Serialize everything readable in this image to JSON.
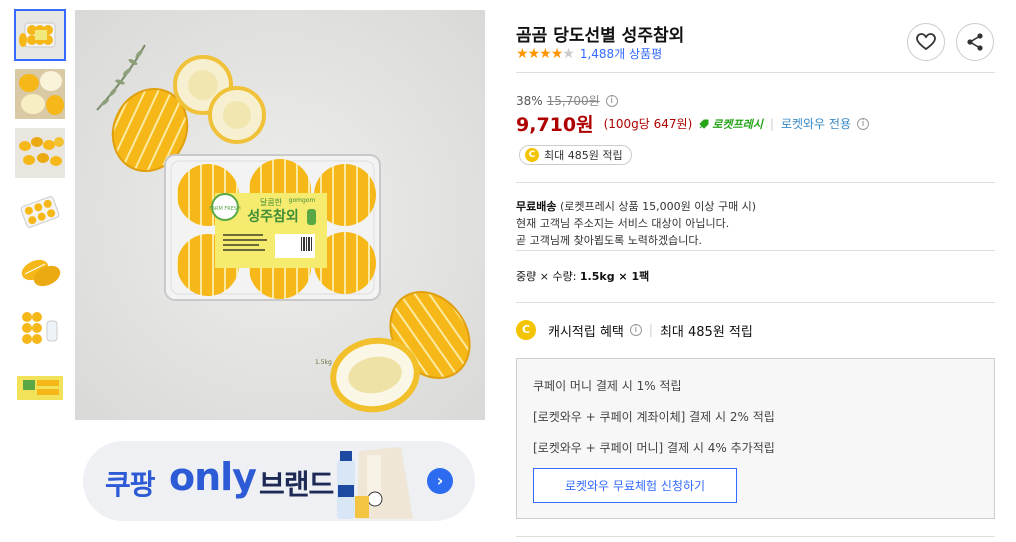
{
  "product": {
    "title": "곰곰 당도선별 성주참외",
    "rating": 4,
    "rating_max": 5,
    "review_count": "1,488개 상품평",
    "discount_rate": "38%",
    "original_price": "15,700원",
    "sale_price": "9,710원",
    "unit_price": "(100g당 647원)",
    "rocket_label": "로켓프레시",
    "wow_label": "로켓와우 전용",
    "cash_pill": "최대 485원 적립",
    "coin_symbol": "C"
  },
  "shipping": {
    "title": "무료배송",
    "condition": "(로켓프레시 상품 15,000원 이상 구매 시)",
    "line2": "현재 고객님 주소지는 서비스 대상이 아닙니다.",
    "line3": "곧 고객님께 찾아뵙도록 노력하겠습니다."
  },
  "spec": {
    "label": "중량 × 수량:",
    "value": "1.5kg × 1팩"
  },
  "cashback": {
    "label": "캐시적립 혜택",
    "value": "최대 485원 적립"
  },
  "benefits": {
    "lines": [
      "쿠페이 머니 결제 시 1% 적립",
      "[로켓와우 + 쿠페이 계좌이체] 결제 시 2% 적립",
      "[로켓와우 + 쿠페이 머니] 결제 시 4% 추가적립"
    ],
    "button": "로켓와우 무료체험 신청하기"
  },
  "banner": {
    "brand_ko": "쿠팡",
    "only": "only",
    "brand_word": "브랜드",
    "arrow": "›"
  },
  "image_label": {
    "badge": "FARM FRESH",
    "name_small": "달콤한",
    "name_big": "성주참외",
    "brand": "gomgom",
    "weight": "1.5kg"
  },
  "icons": {
    "heart": "heart-icon",
    "share": "share-icon",
    "info": "info-icon"
  },
  "colors": {
    "accent": "#346aff",
    "price": "#ae0000",
    "rocket": "#26a319",
    "star": "#ff9600",
    "coin": "#f5c400",
    "melon": "#f6b718"
  }
}
